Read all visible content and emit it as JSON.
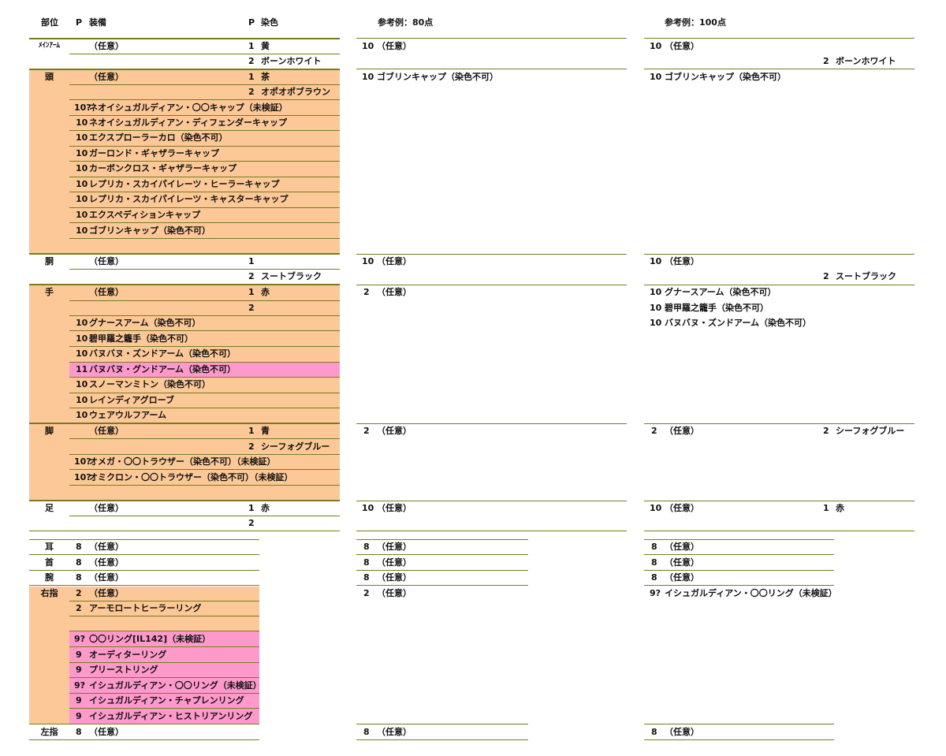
{
  "header": {
    "part": "部位",
    "p1": "P",
    "equip": "装備",
    "p2": "P",
    "dye": "染色",
    "ref80": "参考例：80点",
    "ref100": "参考例：100点"
  },
  "main": [
    {
      "part": "ﾒｲﾝｱｰﾑ",
      "rows": [
        {
          "p": "",
          "name": "（任意）",
          "dp": "1",
          "dye": "黄"
        },
        {
          "p": "",
          "name": "",
          "dp": "2",
          "dye": "ボーンホワイト"
        }
      ]
    },
    {
      "part": "頭",
      "rows": [
        {
          "p": "",
          "name": "（任意）",
          "dp": "1",
          "dye": "茶"
        },
        {
          "p": "",
          "name": "",
          "dp": "2",
          "dye": "オポオポブラウン"
        },
        {
          "p": "10?",
          "name": "ネオイシュガルディアン・〇〇キャップ（未検証）"
        },
        {
          "p": "10",
          "name": "ネオイシュガルディアン・ディフェンダーキャップ"
        },
        {
          "p": "10",
          "name": "エクスプローラーカロ（染色不可）"
        },
        {
          "p": "10",
          "name": "ガーロンド・ギャザラーキャップ"
        },
        {
          "p": "10",
          "name": "カーボンクロス・ギャザラーキャップ"
        },
        {
          "p": "10",
          "name": "レプリカ・スカイパイレーツ・ヒーラーキャップ"
        },
        {
          "p": "10",
          "name": "レプリカ・スカイパイレーツ・キャスターキャップ"
        },
        {
          "p": "10",
          "name": "エクスペディションキャップ"
        },
        {
          "p": "10",
          "name": "ゴブリンキャップ（染色不可）"
        }
      ]
    },
    {
      "part": "胴",
      "rows": [
        {
          "p": "",
          "name": "（任意）",
          "dp": "1",
          "dye": ""
        },
        {
          "p": "",
          "name": "",
          "dp": "2",
          "dye": "スートブラック"
        }
      ]
    },
    {
      "part": "手",
      "rows": [
        {
          "p": "",
          "name": "（任意）",
          "dp": "1",
          "dye": "赤"
        },
        {
          "p": "",
          "name": "",
          "dp": "2",
          "dye": ""
        },
        {
          "p": "10",
          "name": "グナースアーム（染色不可）"
        },
        {
          "p": "10",
          "name": "碧甲羅之籠手（染色不可）"
        },
        {
          "p": "10",
          "name": "バヌバヌ・ズンドアーム（染色不可）"
        },
        {
          "p": "11",
          "name": "バヌバヌ・グンドアーム（染色不可）",
          "highlight": true
        },
        {
          "p": "10",
          "name": "スノーマンミトン（染色不可）"
        },
        {
          "p": "10",
          "name": "レインディアグローブ"
        },
        {
          "p": "10",
          "name": "ウェアウルフアーム"
        }
      ]
    },
    {
      "part": "脚",
      "rows": [
        {
          "p": "",
          "name": "（任意）",
          "dp": "1",
          "dye": "青"
        },
        {
          "p": "",
          "name": "",
          "dp": "2",
          "dye": "シーフォグブルー"
        },
        {
          "p": "10?",
          "name": "オメガ・〇〇トラウザー（染色不可）（未検証）"
        },
        {
          "p": "10?",
          "name": "オミクロン・〇〇トラウザー（染色不可）（未検証）"
        }
      ]
    },
    {
      "part": "足",
      "rows": [
        {
          "p": "",
          "name": "（任意）",
          "dp": "1",
          "dye": "赤"
        },
        {
          "p": "",
          "name": "",
          "dp": "2",
          "dye": ""
        }
      ]
    }
  ],
  "accessories": [
    {
      "part": "耳",
      "rows": [
        {
          "p": "8",
          "name": "（任意）"
        }
      ]
    },
    {
      "part": "首",
      "rows": [
        {
          "p": "8",
          "name": "（任意）"
        }
      ]
    },
    {
      "part": "腕",
      "rows": [
        {
          "p": "8",
          "name": "（任意）"
        }
      ]
    },
    {
      "part": "右指",
      "rows": [
        {
          "p": "2",
          "name": "（任意）"
        },
        {
          "p": "2",
          "name": "アーモロートヒーラーリング"
        },
        {
          "p": "9?",
          "name": "〇〇リング[IL142]（未検証）",
          "highlight": true
        },
        {
          "p": "9",
          "name": "オーディターリング",
          "highlight": true
        },
        {
          "p": "9",
          "name": "プリーストリング",
          "highlight": true
        },
        {
          "p": "9?",
          "name": "イシュガルディアン・〇〇リング（未検証）",
          "highlight": true
        },
        {
          "p": "9",
          "name": "イシュガルディアン・チャプレンリング",
          "highlight": true
        },
        {
          "p": "9",
          "name": "イシュガルディアン・ヒストリアンリング",
          "highlight": true
        }
      ]
    },
    {
      "part": "左指",
      "rows": [
        {
          "p": "8",
          "name": "（任意）"
        }
      ]
    }
  ],
  "ref80": {
    "main": [
      {
        "p": "10",
        "name": "（任意）"
      },
      {
        "p": "10",
        "name": "ゴブリンキャップ（染色不可）"
      },
      {
        "p": "10",
        "name": "（任意）"
      },
      {
        "p": "2",
        "name": "（任意）"
      },
      {
        "p": "2",
        "name": "（任意）"
      },
      {
        "p": "10",
        "name": "（任意）"
      }
    ],
    "acc": [
      {
        "p": "8",
        "name": "（任意）"
      },
      {
        "p": "8",
        "name": "（任意）"
      },
      {
        "p": "8",
        "name": "（任意）"
      },
      {
        "p": "2",
        "name": "（任意）"
      },
      {
        "p": "8",
        "name": "（任意）"
      }
    ]
  },
  "ref100": {
    "main": [
      {
        "p": "10",
        "name": "（任意）",
        "dp": "2",
        "dye": "ボーンホワイト"
      },
      {
        "p": "10",
        "name": "ゴブリンキャップ（染色不可）"
      },
      {
        "p": "10",
        "name": "（任意）",
        "dp": "2",
        "dye": "スートブラック"
      },
      {
        "p": "10",
        "name": "グナースアーム（染色不可）"
      },
      {
        "p": "10",
        "name": "碧甲羅之籠手（染色不可）"
      },
      {
        "p": "10",
        "name": "バヌバヌ・ズンドアーム（染色不可）"
      },
      {
        "p": "2",
        "name": "（任意）",
        "dp": "2",
        "dye": "シーフォグブルー"
      },
      {
        "p": "10",
        "name": "（任意）",
        "dp": "1",
        "dye": "赤"
      }
    ],
    "acc": [
      {
        "p": "8",
        "name": "（任意）"
      },
      {
        "p": "8",
        "name": "（任意）"
      },
      {
        "p": "8",
        "name": "（任意）"
      },
      {
        "p": "9?",
        "name": "イシュガルディアン・〇〇リング（未検証）"
      },
      {
        "p": "8",
        "name": "（任意）"
      }
    ]
  }
}
